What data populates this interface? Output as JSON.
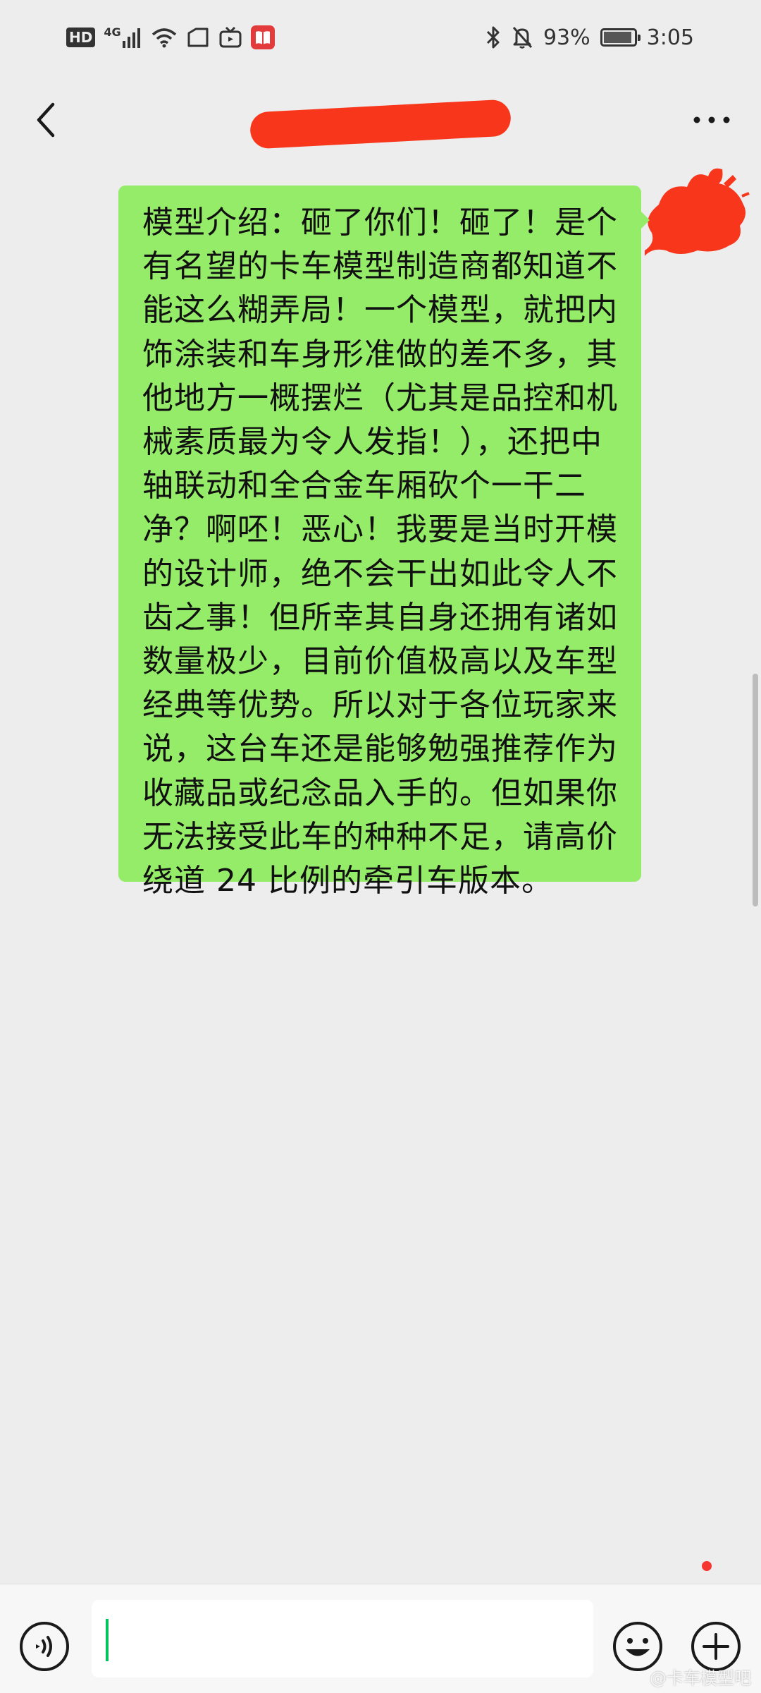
{
  "status_bar": {
    "hd": "HD",
    "net_type": "4G",
    "battery": "93%",
    "battery_level": 0.93,
    "time": "3:05"
  },
  "nav": {
    "back_icon": "chevron-left-icon",
    "more_icon": "more-dots-icon"
  },
  "message": {
    "text": "模型介绍：砸了你们！砸了！是个有名望的卡车模型制造商都知道不能这么糊弄局！一个模型，就把内饰涂装和车身形准做的差不多，其他地方一概摆烂（尤其是品控和机械素质最为令人发指！），还把中轴联动和全合金车厢砍个一干二净？啊呸！恶心！我要是当时开模的设计师，绝不会干出如此令人不齿之事！但所幸其自身还拥有诸如数量极少，目前价值极高以及车型经典等优势。所以对于各位玩家来说，这台车还是能够勉强推荐作为收藏品或纪念品入手的。但如果你无法接受此车的种种不足，请高价绕道 24 比例的牵引车版本。",
    "bubble_color": "#95ec69"
  },
  "input_bar": {
    "value": "",
    "voice_icon": "voice-icon",
    "emoji_icon": "emoji-icon",
    "plus_icon": "plus-icon",
    "accent": "#07c160"
  },
  "watermark": "@卡车模型吧",
  "colors": {
    "background": "#ededed",
    "redaction": "#f7361b",
    "unread_dot": "#f43530"
  }
}
